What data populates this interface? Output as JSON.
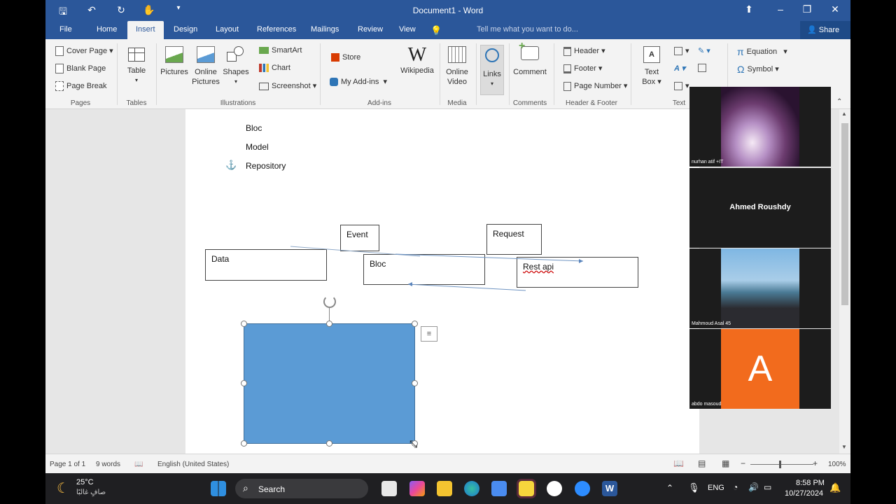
{
  "window": {
    "title": "Document1 - Word"
  },
  "tabs": [
    "File",
    "Home",
    "Insert",
    "Design",
    "Layout",
    "References",
    "Mailings",
    "Review",
    "View"
  ],
  "active_tab": "Insert",
  "tell_me": "Tell me what you want to do...",
  "share_label": "Share",
  "ribbon": {
    "pages": {
      "cover_page": "Cover Page",
      "blank_page": "Blank Page",
      "page_break": "Page Break",
      "group": "Pages"
    },
    "tables": {
      "table": "Table",
      "group": "Tables"
    },
    "illustrations": {
      "pictures": "Pictures",
      "online_pictures_1": "Online",
      "online_pictures_2": "Pictures",
      "shapes": "Shapes",
      "smartart": "SmartArt",
      "chart": "Chart",
      "screenshot": "Screenshot",
      "group": "Illustrations"
    },
    "addins": {
      "store": "Store",
      "my_addins": "My Add-ins",
      "wikipedia": "Wikipedia",
      "group": "Add-ins"
    },
    "media": {
      "online_video_1": "Online",
      "online_video_2": "Video",
      "group": "Media"
    },
    "links": {
      "links": "Links"
    },
    "comments": {
      "comment": "Comment",
      "group": "Comments"
    },
    "header_footer": {
      "header": "Header",
      "footer": "Footer",
      "page_number": "Page Number",
      "group": "Header & Footer"
    },
    "text": {
      "text_box_1": "Text",
      "text_box_2": "Box",
      "group": "Text"
    },
    "symbols": {
      "equation": "Equation",
      "symbol": "Symbol"
    }
  },
  "document": {
    "lines": [
      "Bloc",
      "Model",
      "Repository"
    ],
    "boxes": {
      "event": "Event",
      "request": "Request",
      "data": "Data",
      "bloc": "Bloc",
      "rest_api": "Rest api"
    }
  },
  "participants": [
    {
      "name": "nurhan atif +IT"
    },
    {
      "name": "Ahmed Roushdy"
    },
    {
      "name": "Mahmoud Asal 45"
    },
    {
      "name": "abdo masoud",
      "initial": "A"
    }
  ],
  "status": {
    "page": "Page 1 of 1",
    "words": "9 words",
    "language": "English (United States)",
    "zoom": "100%"
  },
  "taskbar": {
    "temp": "25°C",
    "weather": "صافٍ غالبًا",
    "search": "Search",
    "lang": "ENG",
    "time": "8:58 PM",
    "date": "10/27/2024"
  },
  "colors": {
    "word_blue": "#2b579a",
    "shape_fill": "#5b9bd5",
    "avatar_orange": "#f26b1d"
  }
}
